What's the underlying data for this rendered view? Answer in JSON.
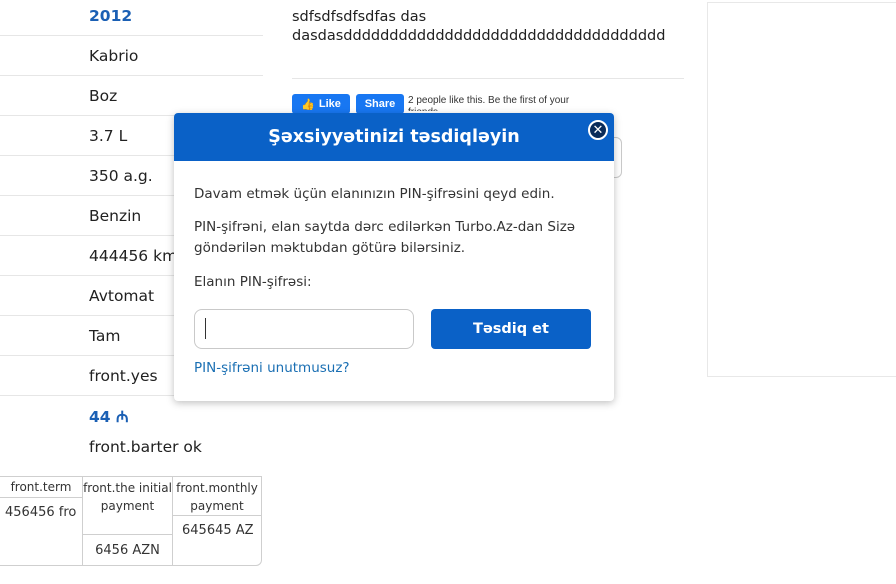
{
  "specs": [
    "2012",
    "Kabrio",
    "Boz",
    "3.7 L",
    "350 a.g.",
    "Benzin",
    "444456 km",
    "Avtomat",
    "Tam",
    "front.yes",
    "44 ₼"
  ],
  "barter": "front.barter ok",
  "credit": {
    "term_header": "front.term",
    "initial_header": "front.the initial payment",
    "monthly_header": "front.monthly payment",
    "term_value": "456456 fro",
    "initial_value": "6456 AZN",
    "monthly_value": "645645 AZ"
  },
  "description": {
    "line1": "sdfsdfsdfsdfas das",
    "line2": "dasdasddddddddddddddddddddddddddddddddddd"
  },
  "facebook": {
    "like_label": "Like",
    "share_label": "Share",
    "text": "2 people like this. Be the first of your friends."
  },
  "modal": {
    "title": "Şəxsiyyətinizi təsdiqləyin",
    "paragraph1": "Davam etmək üçün elanınızın PIN-şifrəsini qeyd edin.",
    "paragraph2": "PIN-şifrəni, elan saytda dərc edilərkən Turbo.Az-dan Sizə göndərilən məktubdan götürə bilərsiniz.",
    "pin_label": "Elanın PIN-şifrəsi:",
    "pin_value": "",
    "confirm_label": "Təsdiq et",
    "forgot_label": "PIN-şifrəni unutmusuz?"
  },
  "colors": {
    "primary": "#0a61c7",
    "link": "#1a5fb4",
    "fb": "#1877f2"
  }
}
